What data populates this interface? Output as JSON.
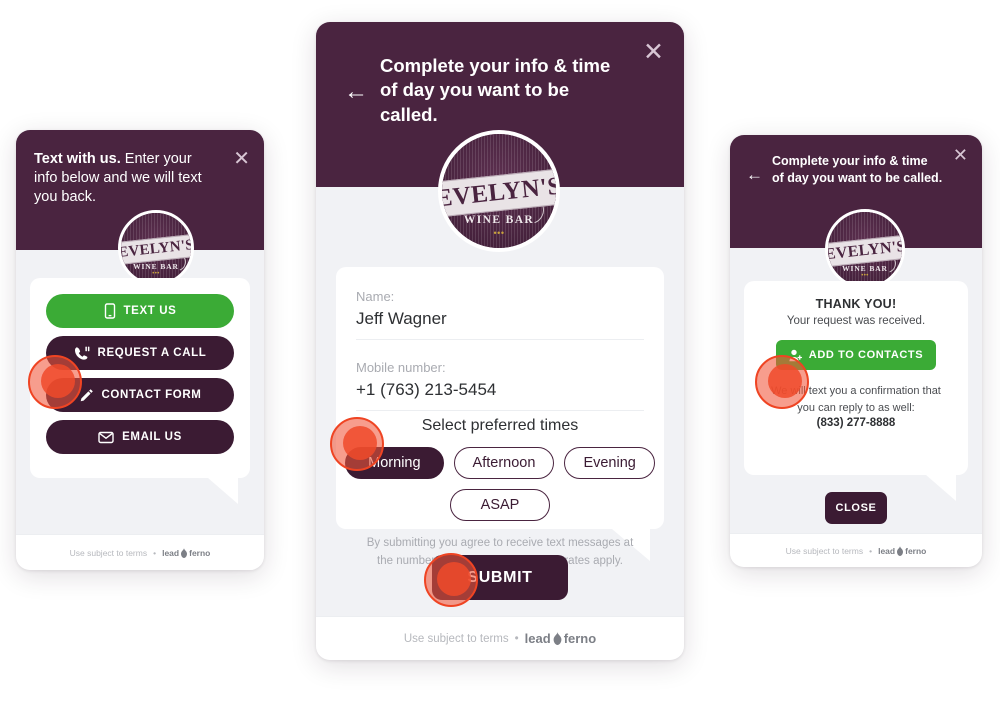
{
  "colors": {
    "plum": "#4a2440",
    "plum_dark": "#3b1b33",
    "green": "#3bab36",
    "panel_bg": "#f1f2f5",
    "click": "#ef4423"
  },
  "logo": {
    "name": "EVELYN'S",
    "subtitle": "WINE BAR",
    "grapes": "•••"
  },
  "footer": {
    "terms": "Use subject to terms",
    "separator": "•",
    "brand_first": "lead",
    "brand_last": "ferno"
  },
  "panel1": {
    "header": {
      "bold": "Text with us.",
      "rest": " Enter your info below and we will text you back.",
      "close_icon": "close-icon"
    },
    "buttons": [
      {
        "label": "TEXT US",
        "icon": "mobile-phone-icon",
        "style": "green"
      },
      {
        "label": "REQUEST A CALL",
        "icon": "phone-callback-icon",
        "style": "dark"
      },
      {
        "label": "CONTACT FORM",
        "icon": "pencil-icon",
        "style": "dark"
      },
      {
        "label": "EMAIL US",
        "icon": "envelope-icon",
        "style": "dark"
      }
    ]
  },
  "panel2": {
    "header": {
      "line1": "Complete your info & time",
      "line2": "of day you want to be called.",
      "back_icon": "back-arrow-icon",
      "close_icon": "close-icon"
    },
    "form": {
      "name_label": "Name:",
      "name_value": "Jeff Wagner",
      "mobile_label": "Mobile number:",
      "mobile_value": "+1 (763) 213-5454",
      "times_title": "Select preferred times",
      "time_options": [
        {
          "label": "Morning",
          "selected": true
        },
        {
          "label": "Afternoon",
          "selected": false
        },
        {
          "label": "Evening",
          "selected": false
        },
        {
          "label": "ASAP",
          "selected": false
        }
      ],
      "disclaimer_line1": "By submitting you agree to receive text messages at",
      "disclaimer_line2": "the number provided. Message/data rates apply.",
      "submit_label": "SUBMIT"
    }
  },
  "panel3": {
    "header": {
      "line1": "Complete your info & time",
      "line2": "of day you want to be called.",
      "back_icon": "back-arrow-icon",
      "close_icon": "close-icon"
    },
    "thankyou": {
      "title": "THANK YOU!",
      "subtitle": "Your request was received.",
      "add_contacts_label": "ADD TO CONTACTS",
      "add_contacts_icon": "add-person-icon",
      "note_line1": "We will text you a confirmation that",
      "note_line2": "you can reply to as well:",
      "phone": "(833) 277-8888",
      "close_label": "CLOSE"
    }
  }
}
